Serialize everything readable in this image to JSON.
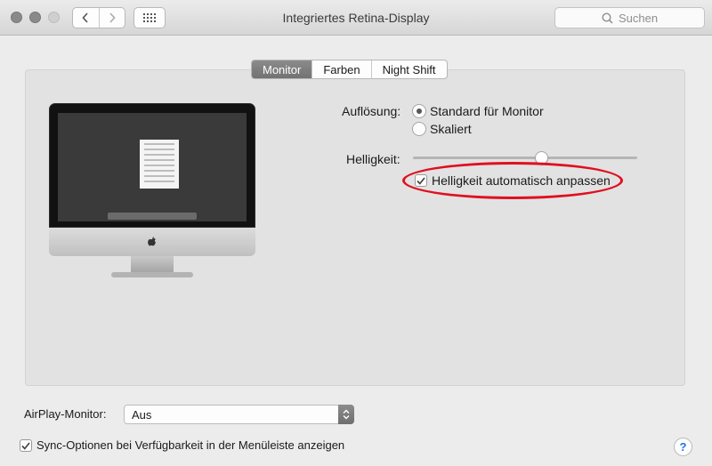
{
  "window": {
    "title": "Integriertes Retina-Display"
  },
  "search": {
    "placeholder": "Suchen"
  },
  "tabs": [
    {
      "label": "Monitor",
      "active": true
    },
    {
      "label": "Farben",
      "active": false
    },
    {
      "label": "Night Shift",
      "active": false
    }
  ],
  "display": {
    "resolution_label": "Auflösung:",
    "resolution_options": [
      {
        "label": "Standard für Monitor",
        "selected": true
      },
      {
        "label": "Skaliert",
        "selected": false
      }
    ],
    "brightness_label": "Helligkeit:",
    "brightness_value": 0.58,
    "auto_brightness_label": "Helligkeit automatisch anpassen",
    "auto_brightness_checked": true
  },
  "airplay": {
    "label": "AirPlay-Monitor:",
    "value": "Aus"
  },
  "sync_option": {
    "label": "Sync-Optionen bei Verfügbarkeit in der Menüleiste anzeigen",
    "checked": true
  },
  "help": {
    "label": "?"
  },
  "colors": {
    "annotation": "#e01020",
    "tab_active": "#7e7e7e",
    "help": "#1e78e6"
  }
}
